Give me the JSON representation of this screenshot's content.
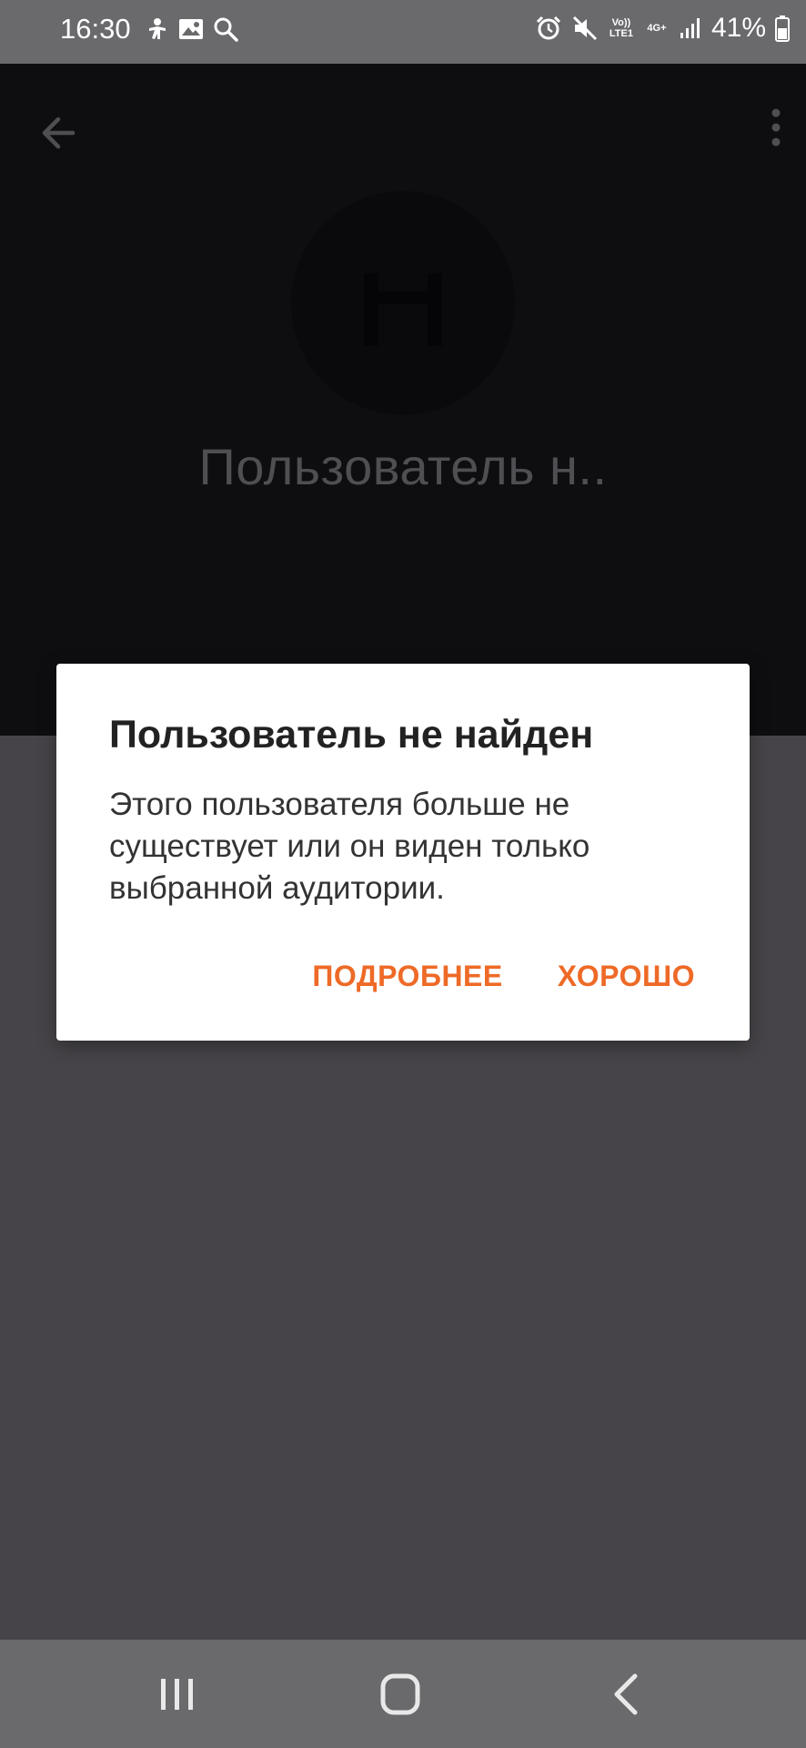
{
  "status_bar": {
    "time": "16:30",
    "battery_percent": "41%",
    "volte_label": "Vo)) LTE1",
    "network_label": "4G+",
    "left_icons": [
      "accessibility-icon",
      "gallery-icon",
      "search-icon"
    ],
    "right_icons": [
      "alarm-icon",
      "mute-icon",
      "volte-icon",
      "4g-icon",
      "signal-icon",
      "battery-icon"
    ]
  },
  "profile": {
    "name": "Пользователь н.."
  },
  "dialog": {
    "title": "Пользователь не найден",
    "message": "Этого пользователя больше не существует или он виден только выбранной аудитории.",
    "buttons": {
      "more_label": "ПОДРОБНЕЕ",
      "ok_label": "ХОРОШО"
    },
    "accent_color": "#EE6A27"
  },
  "nav_bar": {
    "buttons": [
      "recents-icon",
      "home-icon",
      "back-icon"
    ]
  }
}
